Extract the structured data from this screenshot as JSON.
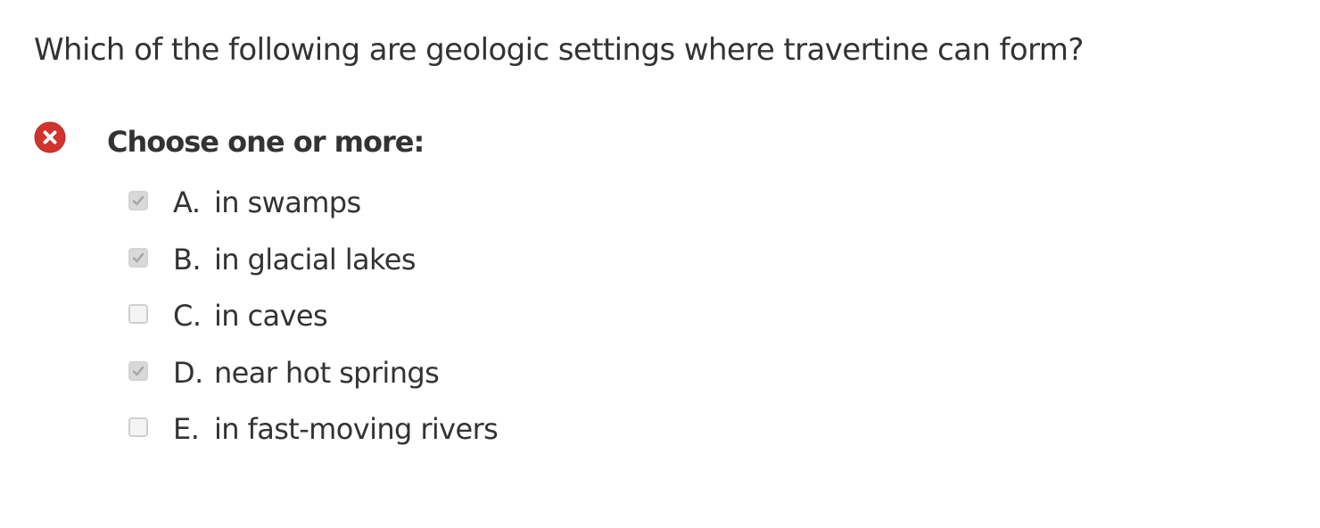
{
  "question": {
    "text": "Which of the following are geologic settings where travertine can form?"
  },
  "status": {
    "icon": "incorrect-x-icon",
    "color": "#d0342c"
  },
  "prompt": "Choose one or more:",
  "options": [
    {
      "letter": "A.",
      "text": "in swamps",
      "checked": true
    },
    {
      "letter": "B.",
      "text": "in glacial lakes",
      "checked": true
    },
    {
      "letter": "C.",
      "text": "in caves",
      "checked": false
    },
    {
      "letter": "D.",
      "text": "near hot springs",
      "checked": true
    },
    {
      "letter": "E.",
      "text": "in fast-moving rivers",
      "checked": false
    }
  ]
}
